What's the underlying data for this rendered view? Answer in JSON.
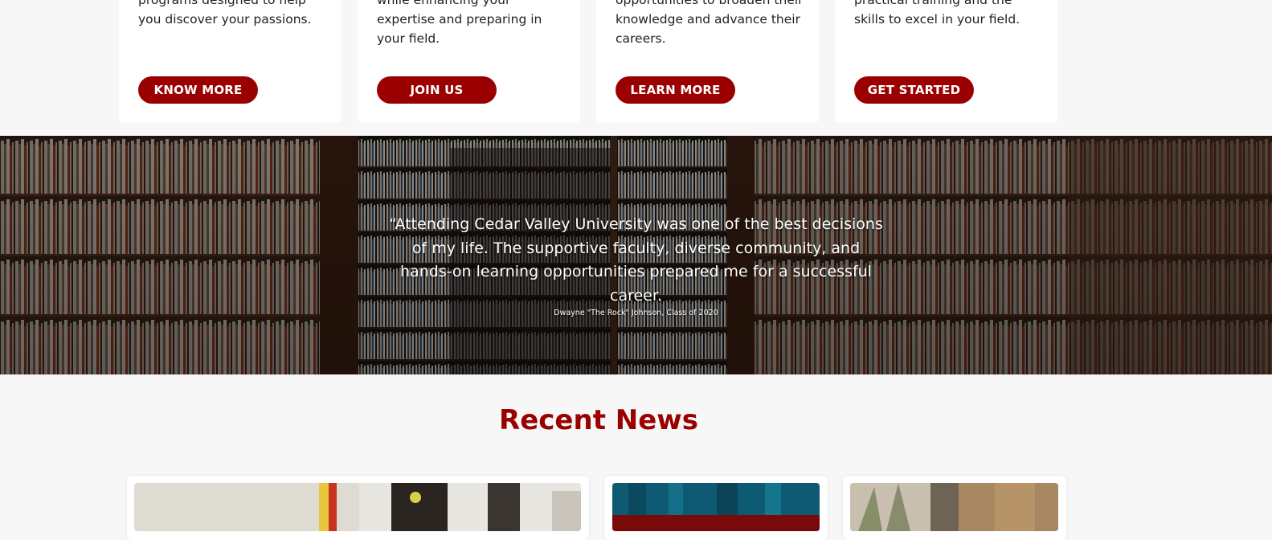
{
  "cards": [
    {
      "text": "programs designed to help you discover your passions.",
      "button_label": "KNOW MORE"
    },
    {
      "text": "while enhancing your expertise and preparing in your field.",
      "button_label": "JOIN US"
    },
    {
      "text": "opportunities to broaden their knowledge and advance their careers.",
      "button_label": "LEARN MORE"
    },
    {
      "text": "practical training and the skills to excel in your field.",
      "button_label": "GET STARTED"
    }
  ],
  "testimonial": {
    "quote": "“Attending Cedar Valley University was one of the best decisions of my life. The supportive faculty, diverse community, and hands-on learning opportunities prepared me for a successful career.",
    "attribution": "Dwayne \"The Rock\" Johnson, Class of 2020"
  },
  "news": {
    "title": "Recent News"
  },
  "colors": {
    "accent": "#9b0000",
    "background": "#f7f7f7",
    "card": "#ffffff"
  }
}
